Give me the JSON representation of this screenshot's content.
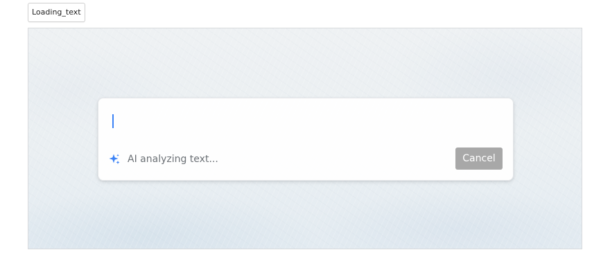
{
  "story": {
    "label": "Loading_text"
  },
  "panel": {
    "input_value": "",
    "status_icon": "sparkle-icon",
    "status_text": "AI analyzing text...",
    "cancel_label": "Cancel"
  },
  "colors": {
    "caret": "#3b82f6",
    "sparkle": "#3b82f6",
    "cancel_bg": "#a8a8a8",
    "status_text": "#6b7075"
  }
}
